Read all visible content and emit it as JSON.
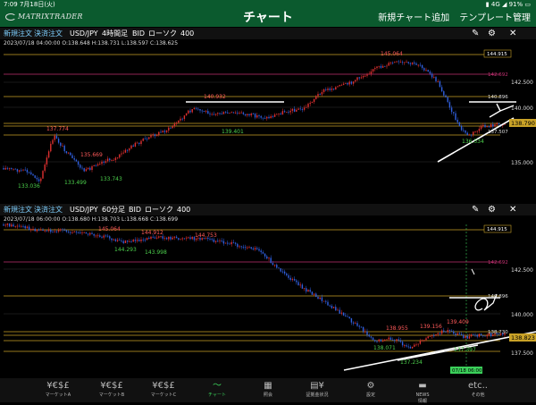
{
  "status": {
    "time": "7:09",
    "date": "7月18日(火)",
    "network": "4G",
    "battery": "91%"
  },
  "header": {
    "logo": "MATRIXTRADER",
    "title": "チャート",
    "link_add": "新規チャート追加",
    "link_template": "テンプレート管理"
  },
  "charts": [
    {
      "order_new": "新規注文",
      "order_settle": "決済注文",
      "pair": "USD/JPY",
      "timeframe": "4時間足",
      "bid": "BID",
      "candle": "ローソク",
      "count": "400",
      "info": "2023/07/18 04:00:00    O:138.648  H:138.731  L:138.597  C:138.625",
      "axis_labels": [
        "142.500",
        "140.000",
        "137.507",
        "135.000"
      ],
      "price_tags": {
        "p1": "144.915",
        "p2": "142.692",
        "p3": "140.896",
        "current": "138.790"
      },
      "annotations": [
        "137.774",
        "135.669",
        "133.036",
        "133.499",
        "133.743",
        "140.932",
        "139.401",
        "145.064",
        "136.534"
      ]
    },
    {
      "order_new": "新規注文",
      "order_settle": "決済注文",
      "pair": "USD/JPY",
      "timeframe": "60分足",
      "bid": "BID",
      "candle": "ローソク",
      "count": "400",
      "info": "2023/07/18 06:00:00    O:138.680  H:138.703  L:138.668  C:138.699",
      "axis_labels": [
        "142.500",
        "140.000",
        "137.500"
      ],
      "price_tags": {
        "p1": "144.915",
        "p2": "142.692",
        "p3": "140.896",
        "p4": "138.730",
        "current": "138.823",
        "date": "07/18 06:00"
      },
      "annotations": [
        "145.064",
        "144.293",
        "144.912",
        "143.998",
        "144.753",
        "138.955",
        "139.156",
        "139.409",
        "138.071",
        "137.234",
        "137.397"
      ]
    }
  ],
  "tabs": [
    {
      "icon": "¥€$£",
      "label": "マーケットA"
    },
    {
      "icon": "¥€$£",
      "label": "マーケットB"
    },
    {
      "icon": "¥€$£",
      "label": "マーケットC"
    },
    {
      "icon": "〜",
      "label": "チャート"
    },
    {
      "icon": "▦",
      "label": "照会"
    },
    {
      "icon": "▤¥",
      "label": "証拠金状況"
    },
    {
      "icon": "⚙",
      "label": "設定"
    },
    {
      "icon": "▬",
      "label": "NEWS\n情報"
    },
    {
      "icon": "etc..",
      "label": "その他"
    }
  ],
  "colors": {
    "accent": "#0b5a2e",
    "bull": "#e03030",
    "bear": "#3060e0",
    "active_tab": "#3bd05a"
  }
}
